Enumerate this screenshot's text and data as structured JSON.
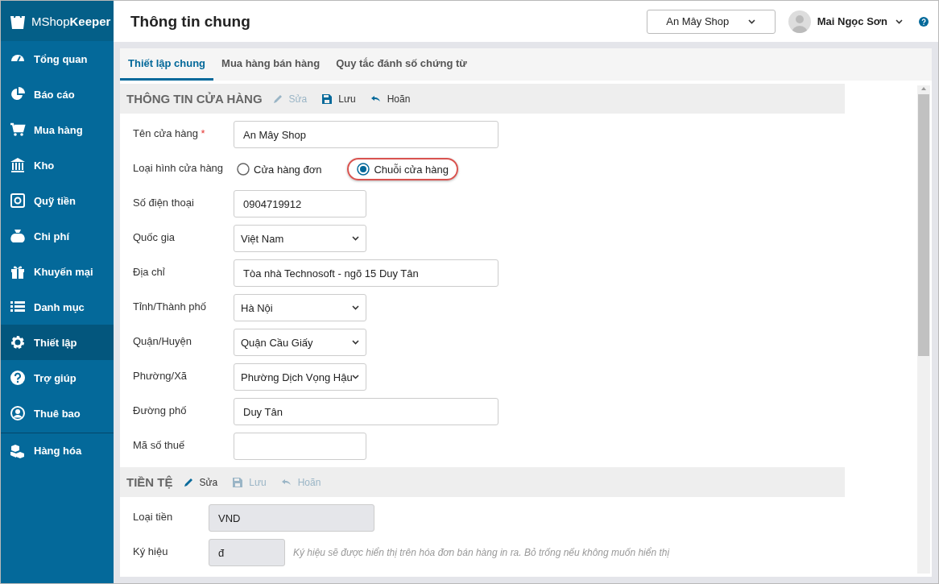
{
  "sidebar": {
    "logo": "MShop**Keeper**",
    "items": [
      {
        "label": "Tổng quan",
        "selected": false
      },
      {
        "label": "Báo cáo",
        "selected": false
      },
      {
        "label": "Mua hàng",
        "selected": false
      },
      {
        "label": "Kho",
        "selected": false
      },
      {
        "label": "Quỹ tiền",
        "selected": false
      },
      {
        "label": "Chi phí",
        "selected": false
      },
      {
        "label": "Khuyến mại",
        "selected": false
      },
      {
        "label": "Danh mục",
        "selected": false
      },
      {
        "label": "Thiết lập",
        "selected": true
      },
      {
        "label": "Trợ giúp",
        "selected": false
      },
      {
        "label": "Thuê bao",
        "selected": false
      },
      {
        "label": "Hàng hóa",
        "selected": false
      }
    ]
  },
  "header": {
    "title": "Thông tin chung",
    "store_select": "An Mây Shop",
    "user_name": "Mai Ngọc Sơn"
  },
  "tabs": [
    {
      "label": "Thiết lập chung",
      "selected": true
    },
    {
      "label": "Mua hàng bán hàng",
      "selected": false
    },
    {
      "label": "Quy tắc đánh số chứng từ",
      "selected": false
    }
  ],
  "sections": [
    {
      "title": "THÔNG TIN CỬA HÀNG",
      "actions": [
        {
          "label": "Sửa",
          "disabled": true
        },
        {
          "label": "Lưu",
          "disabled": false
        },
        {
          "label": "Hoãn",
          "disabled": false
        }
      ],
      "fields": [
        {
          "kind": "text",
          "label": "Tên cửa hàng",
          "required_mark": "*",
          "value": "An Mây Shop",
          "wide": true
        },
        {
          "kind": "radio",
          "label": "Loại hình cửa hàng",
          "options": [
            {
              "label": "Cửa hàng đơn",
              "selected": false,
              "highlighted": false
            },
            {
              "label": "Chuỗi cửa hàng",
              "selected": true,
              "highlighted": true
            }
          ]
        },
        {
          "kind": "text",
          "label": "Số điện thoại",
          "value": "0904719912",
          "wide": false
        },
        {
          "kind": "select",
          "label": "Quốc gia",
          "value": "Việt Nam"
        },
        {
          "kind": "text",
          "label": "Địa chỉ",
          "value": "Tòa nhà Technosoft - ngõ 15 Duy Tân",
          "wide": true
        },
        {
          "kind": "select",
          "label": "Tỉnh/Thành phố",
          "value": "Hà Nội"
        },
        {
          "kind": "select",
          "label": "Quận/Huyện",
          "value": "Quận Cầu Giấy"
        },
        {
          "kind": "select",
          "label": "Phường/Xã",
          "value": "Phường Dịch Vọng Hậu"
        },
        {
          "kind": "text",
          "label": "Đường phố",
          "value": "Duy Tân",
          "wide": true
        },
        {
          "kind": "text",
          "label": "Mã số thuế",
          "wide": false
        }
      ]
    },
    {
      "title": "TIỀN TỆ",
      "actions": [
        {
          "label": "Sửa",
          "disabled": false
        },
        {
          "label": "Lưu",
          "disabled": true
        },
        {
          "label": "Hoãn",
          "disabled": true
        }
      ],
      "fields": [
        {
          "kind": "readonly",
          "label": "Loại tiền",
          "value": "VND",
          "wide": true
        },
        {
          "kind": "readonly",
          "label": "Ký hiệu",
          "value": "đ",
          "wide": false,
          "hint": "Ký hiệu sẽ được hiển thị trên hóa đơn bán hàng in ra. Bỏ trống nếu không muốn hiển thị"
        }
      ]
    }
  ]
}
